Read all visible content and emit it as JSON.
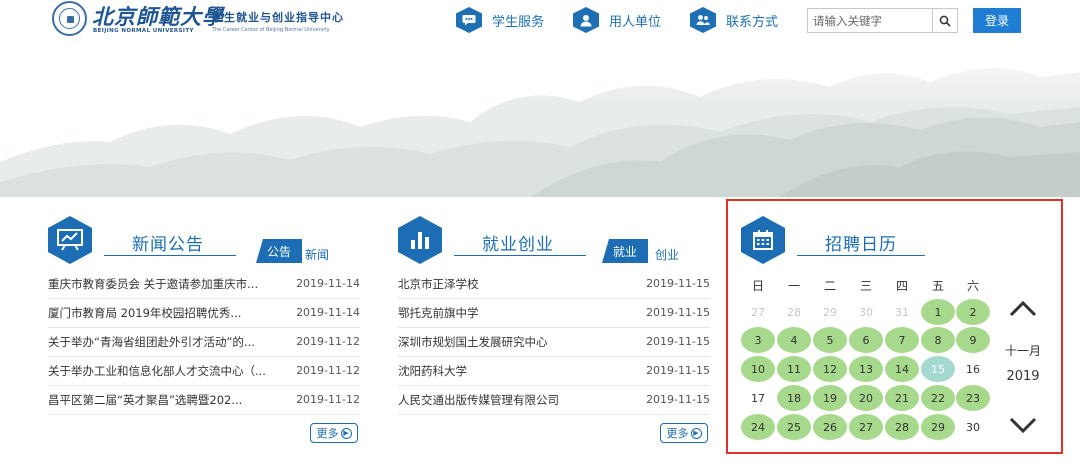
{
  "header": {
    "logo_cn": "北京師範大學",
    "logo_en": "BEIJING NORMAL UNIVERSITY",
    "logo_sub_cn": "学生就业与创业指导中心",
    "logo_sub_en": "The Career Center of Beijing Normal University",
    "nav": [
      {
        "label": "学生服务",
        "icon": "chat-icon"
      },
      {
        "label": "用人单位",
        "icon": "user-icon"
      },
      {
        "label": "联系方式",
        "icon": "contact-icon"
      }
    ],
    "search_placeholder": "请输入关键字",
    "login_label": "登录"
  },
  "news": {
    "title": "新闻公告",
    "tag_active": "公告",
    "tag_other": "新闻",
    "items": [
      {
        "title": "重庆市教育委员会 关于邀请参加重庆市...",
        "date": "2019-11-14"
      },
      {
        "title": "厦门市教育局 2019年校园招聘优秀...",
        "date": "2019-11-14"
      },
      {
        "title": "关于举办“青海省组团赴外引才活动”的...",
        "date": "2019-11-12"
      },
      {
        "title": "关于举办工业和信息化部人才交流中心（...",
        "date": "2019-11-12"
      },
      {
        "title": "昌平区第二届“英才聚昌”选聘暨202...",
        "date": "2019-11-12"
      }
    ],
    "more_label": "更多"
  },
  "jobs": {
    "title": "就业创业",
    "tag_active": "就业",
    "tag_other": "创业",
    "items": [
      {
        "title": "北京市正泽学校",
        "date": "2019-11-15"
      },
      {
        "title": "鄂托克前旗中学",
        "date": "2019-11-15"
      },
      {
        "title": "深圳市规划国土发展研究中心",
        "date": "2019-11-15"
      },
      {
        "title": "沈阳药科大学",
        "date": "2019-11-15"
      },
      {
        "title": "人民交通出版传媒管理有限公司",
        "date": "2019-11-15"
      }
    ],
    "more_label": "更多"
  },
  "calendar": {
    "title": "招聘日历",
    "weekdays": [
      "日",
      "一",
      "二",
      "三",
      "四",
      "五",
      "六"
    ],
    "month_label": "十一月",
    "year_label": "2019",
    "weeks": [
      [
        {
          "n": "27",
          "s": "muted"
        },
        {
          "n": "28",
          "s": "muted"
        },
        {
          "n": "29",
          "s": "muted"
        },
        {
          "n": "30",
          "s": "muted"
        },
        {
          "n": "31",
          "s": "muted"
        },
        {
          "n": "1",
          "s": "green"
        },
        {
          "n": "2",
          "s": "green"
        }
      ],
      [
        {
          "n": "3",
          "s": "green"
        },
        {
          "n": "4",
          "s": "green"
        },
        {
          "n": "5",
          "s": "green"
        },
        {
          "n": "6",
          "s": "green"
        },
        {
          "n": "7",
          "s": "green"
        },
        {
          "n": "8",
          "s": "green"
        },
        {
          "n": "9",
          "s": "green"
        }
      ],
      [
        {
          "n": "10",
          "s": "green"
        },
        {
          "n": "11",
          "s": "green"
        },
        {
          "n": "12",
          "s": "green"
        },
        {
          "n": "13",
          "s": "green"
        },
        {
          "n": "14",
          "s": "green"
        },
        {
          "n": "15",
          "s": "today"
        },
        {
          "n": "16",
          "s": "plain"
        }
      ],
      [
        {
          "n": "17",
          "s": "plain"
        },
        {
          "n": "18",
          "s": "green"
        },
        {
          "n": "19",
          "s": "green"
        },
        {
          "n": "20",
          "s": "green"
        },
        {
          "n": "21",
          "s": "green"
        },
        {
          "n": "22",
          "s": "green"
        },
        {
          "n": "23",
          "s": "green"
        }
      ],
      [
        {
          "n": "24",
          "s": "green"
        },
        {
          "n": "25",
          "s": "green"
        },
        {
          "n": "26",
          "s": "green"
        },
        {
          "n": "27",
          "s": "green"
        },
        {
          "n": "28",
          "s": "green"
        },
        {
          "n": "29",
          "s": "green"
        },
        {
          "n": "30",
          "s": "plain"
        }
      ]
    ],
    "highlight_color": "#a6d98c",
    "today_color": "#a4d9cf",
    "frame_color": "#e0312c"
  },
  "colors": {
    "brand_blue": "#1c6db4",
    "login_blue": "#1f7ed4"
  }
}
